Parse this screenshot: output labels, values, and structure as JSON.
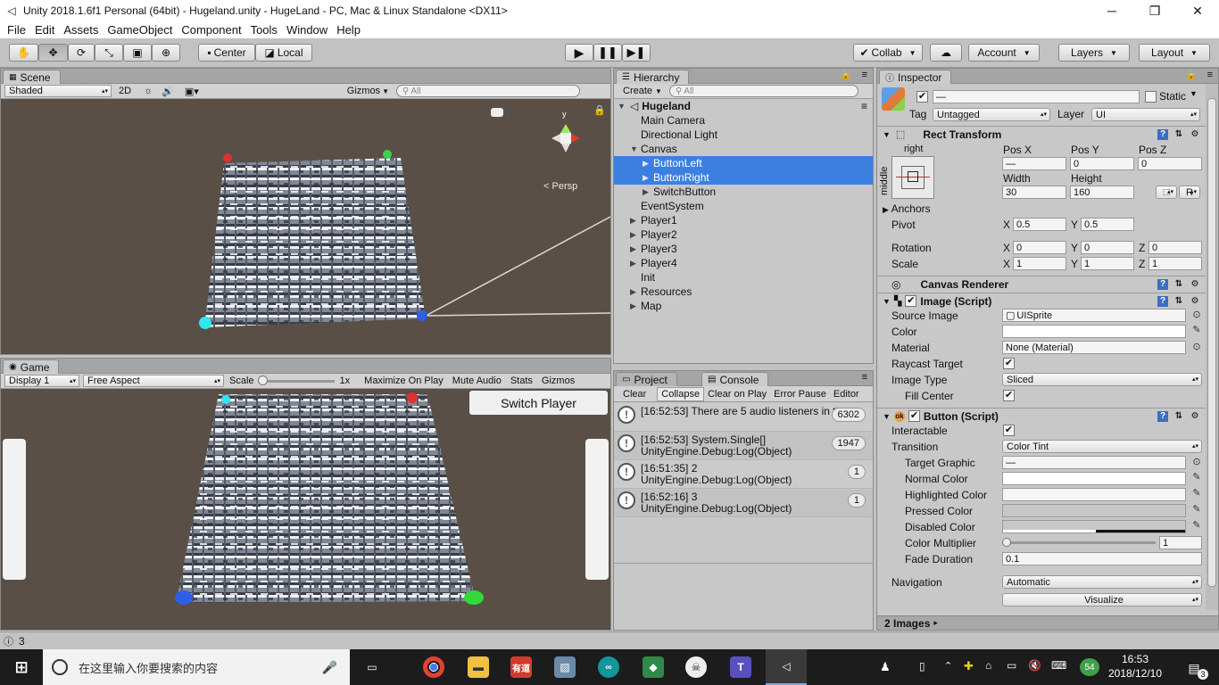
{
  "window": {
    "title": "Unity 2018.1.6f1 Personal (64bit) - Hugeland.unity - HugeLand - PC, Mac & Linux Standalone <DX11>"
  },
  "menu": [
    "File",
    "Edit",
    "Assets",
    "GameObject",
    "Component",
    "Tools",
    "Window",
    "Help"
  ],
  "toolbar": {
    "pivot_label": "Center",
    "space_label": "Local",
    "collab_label": "Collab",
    "account_label": "Account",
    "layers_label": "Layers",
    "layout_label": "Layout"
  },
  "scene": {
    "tab": "Scene",
    "shading": "Shaded",
    "mode2d": "2D",
    "gizmos": "Gizmos",
    "search_placeholder": "All",
    "persp_label": "Persp",
    "gizmo_axis_y": "y"
  },
  "game": {
    "tab": "Game",
    "display": "Display 1",
    "aspect": "Free Aspect",
    "scale_label": "Scale",
    "scale_value": "1x",
    "scale_fraction": 0.0,
    "maximize": "Maximize On Play",
    "mute": "Mute Audio",
    "stats": "Stats",
    "gizmos": "Gizmos",
    "switch_button": "Switch Player"
  },
  "hierarchy": {
    "tab": "Hierarchy",
    "create": "Create",
    "search_placeholder": "All",
    "scene_name": "Hugeland",
    "items": [
      {
        "label": "Main Camera",
        "depth": 1,
        "arrow": "",
        "selected": false
      },
      {
        "label": "Directional Light",
        "depth": 1,
        "arrow": "",
        "selected": false
      },
      {
        "label": "Canvas",
        "depth": 1,
        "arrow": "open",
        "selected": false
      },
      {
        "label": "ButtonLeft",
        "depth": 2,
        "arrow": "closed",
        "selected": true
      },
      {
        "label": "ButtonRight",
        "depth": 2,
        "arrow": "closed",
        "selected": true
      },
      {
        "label": "SwitchButton",
        "depth": 2,
        "arrow": "closed",
        "selected": false
      },
      {
        "label": "EventSystem",
        "depth": 1,
        "arrow": "",
        "selected": false
      },
      {
        "label": "Player1",
        "depth": 1,
        "arrow": "closed",
        "selected": false
      },
      {
        "label": "Player2",
        "depth": 1,
        "arrow": "closed",
        "selected": false
      },
      {
        "label": "Player3",
        "depth": 1,
        "arrow": "closed",
        "selected": false
      },
      {
        "label": "Player4",
        "depth": 1,
        "arrow": "closed",
        "selected": false
      },
      {
        "label": "Init",
        "depth": 1,
        "arrow": "",
        "selected": false
      },
      {
        "label": "Resources",
        "depth": 1,
        "arrow": "closed",
        "selected": false
      },
      {
        "label": "Map",
        "depth": 1,
        "arrow": "closed",
        "selected": false
      }
    ]
  },
  "console": {
    "project_tab": "Project",
    "console_tab": "Console",
    "buttons": [
      "Clear",
      "Collapse",
      "Clear on Play",
      "Error Pause",
      "Editor"
    ],
    "entries": [
      {
        "line1": "[16:52:53] There are 5 audio listeners in the",
        "line2": "",
        "count": "6302"
      },
      {
        "line1": "[16:52:53] System.Single[]",
        "line2": "UnityEngine.Debug:Log(Object)",
        "count": "1947"
      },
      {
        "line1": "[16:51:35] 2",
        "line2": "UnityEngine.Debug:Log(Object)",
        "count": "1"
      },
      {
        "line1": "[16:52:16] 3",
        "line2": "UnityEngine.Debug:Log(Object)",
        "count": "1"
      }
    ]
  },
  "inspector": {
    "tab": "Inspector",
    "name_field": "—",
    "static_label": "Static",
    "tag_label": "Tag",
    "tag_value": "Untagged",
    "layer_label": "Layer",
    "layer_value": "UI",
    "rect_transform": {
      "title": "Rect Transform",
      "anchor_h": "right",
      "anchor_v": "middle",
      "pos_x_label": "Pos X",
      "pos_y_label": "Pos Y",
      "pos_z_label": "Pos Z",
      "pos_x": "—",
      "pos_y": "0",
      "pos_z": "0",
      "width_label": "Width",
      "height_label": "Height",
      "width": "30",
      "height": "160",
      "r_button": "R",
      "anchors_label": "Anchors",
      "pivot_label": "Pivot",
      "pivot_x": "0.5",
      "pivot_y": "0.5",
      "rotation_label": "Rotation",
      "rot_x": "0",
      "rot_y": "0",
      "rot_z": "0",
      "scale_label": "Scale",
      "scale_x": "1",
      "scale_y": "1",
      "scale_z": "1",
      "x": "X",
      "y": "Y",
      "z": "Z"
    },
    "canvas_renderer": {
      "title": "Canvas Renderer"
    },
    "image": {
      "title": "Image (Script)",
      "source_image_label": "Source Image",
      "source_image": "UISprite",
      "color_label": "Color",
      "material_label": "Material",
      "material": "None (Material)",
      "raycast_label": "Raycast Target",
      "image_type_label": "Image Type",
      "image_type": "Sliced",
      "fill_center_label": "Fill Center"
    },
    "button": {
      "title": "Button (Script)",
      "interactable_label": "Interactable",
      "transition_label": "Transition",
      "transition": "Color Tint",
      "target_graphic_label": "Target Graphic",
      "target_graphic": "—",
      "normal_color_label": "Normal Color",
      "highlighted_color_label": "Highlighted Color",
      "pressed_color_label": "Pressed Color",
      "disabled_color_label": "Disabled Color",
      "color_multiplier_label": "Color Multiplier",
      "color_multiplier": "1",
      "fade_duration_label": "Fade Duration",
      "fade_duration": "0.1",
      "navigation_label": "Navigation",
      "navigation": "Automatic",
      "visualize": "Visualize"
    },
    "footer": "2 Images"
  },
  "status": {
    "count": "3"
  },
  "taskbar": {
    "search_placeholder": "在这里输入你要搜索的内容",
    "clock_time": "16:53",
    "clock_date": "2018/12/10",
    "notifications": "3",
    "tray_badge": "54",
    "app_youdao": "有道"
  }
}
